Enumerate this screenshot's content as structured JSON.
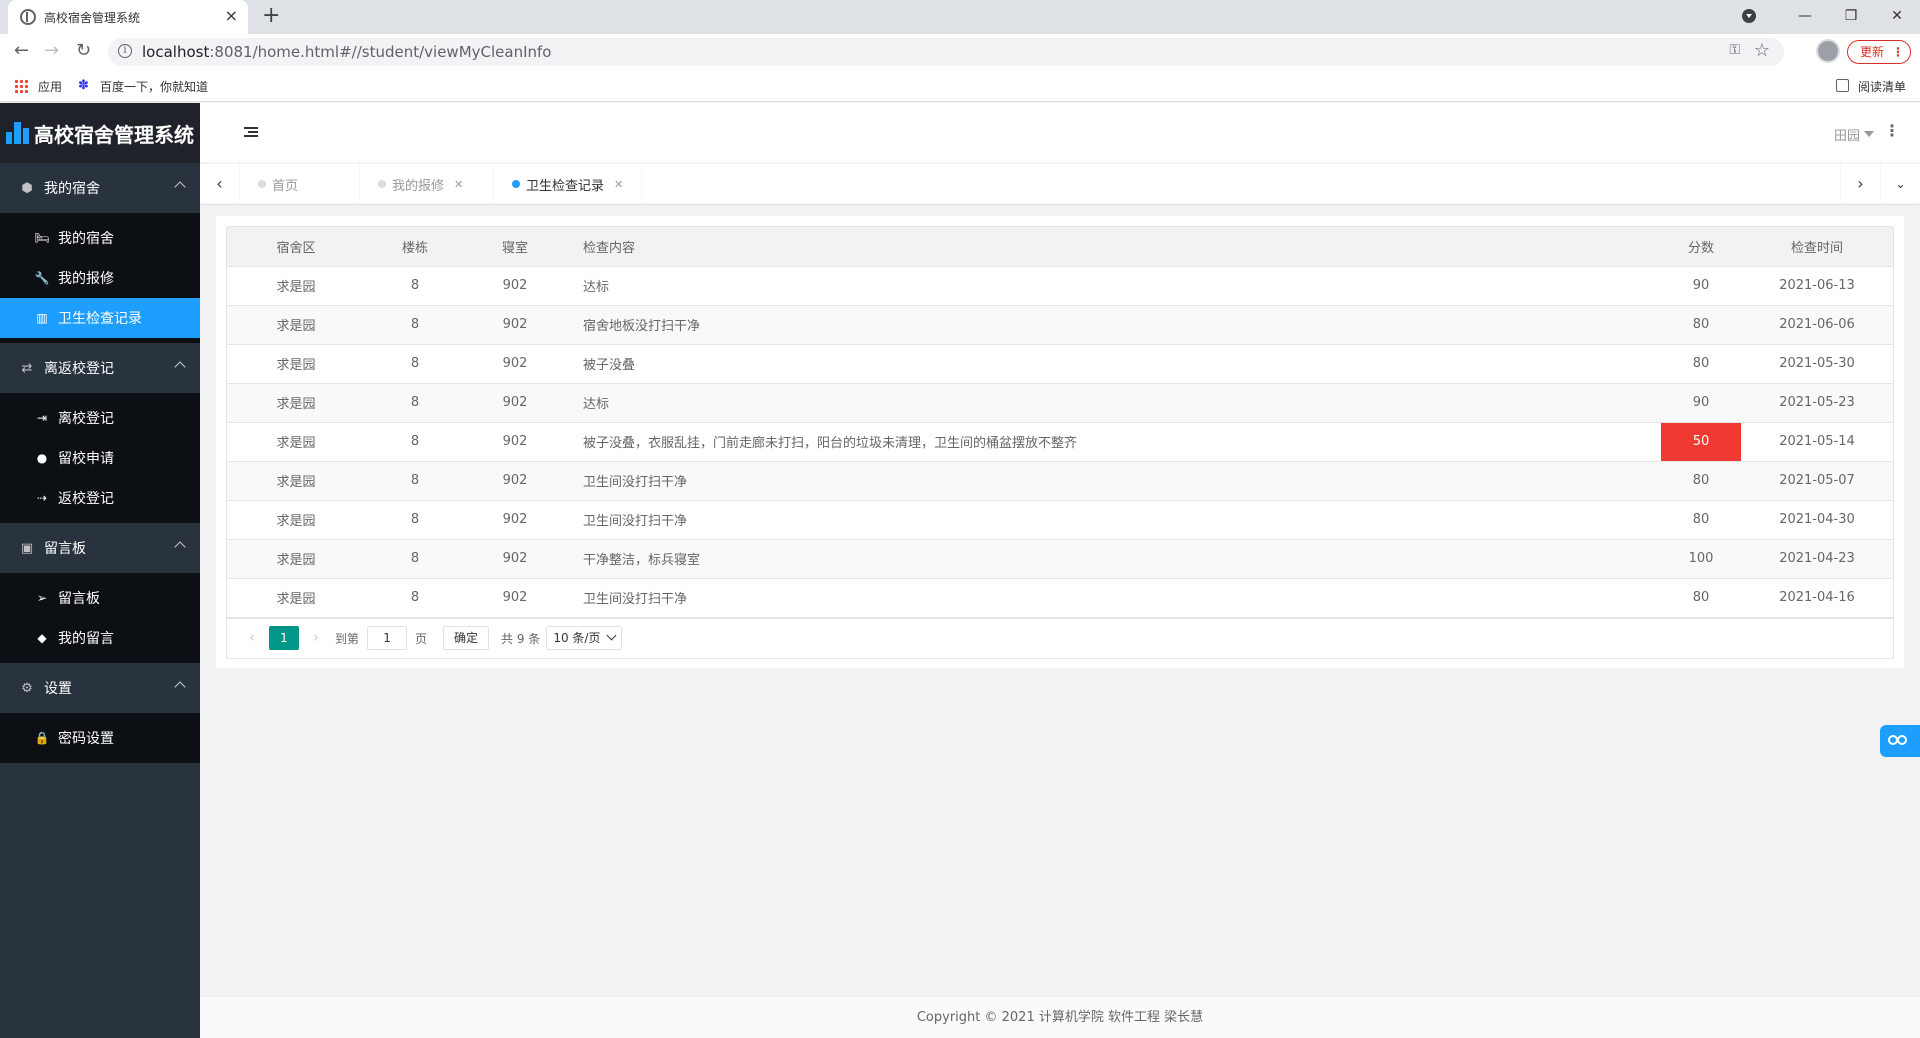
{
  "browser": {
    "tab_title": "高校宿舍管理系统",
    "url_host": "localhost",
    "url_rest": ":8081/home.html#//student/viewMyCleanInfo",
    "update_label": "更新",
    "bookmarks": [
      "应用",
      "百度一下，你就知道"
    ],
    "reading_list": "阅读清单"
  },
  "app": {
    "logo_text": "高校宿舍管理系统",
    "theme_label": "田园"
  },
  "sidebar": {
    "groups": [
      {
        "label": "我的宿舍",
        "icon": "cube-icon",
        "children": [
          {
            "label": "我的宿舍",
            "icon": "bed-icon"
          },
          {
            "label": "我的报修",
            "icon": "wrench-icon"
          },
          {
            "label": "卫生检查记录",
            "icon": "bar-chart-icon",
            "active": true
          }
        ]
      },
      {
        "label": "离返校登记",
        "icon": "exchange-icon",
        "children": [
          {
            "label": "离校登记",
            "icon": "sign-out-icon"
          },
          {
            "label": "留校申请",
            "icon": "globe-icon"
          },
          {
            "label": "返校登记",
            "icon": "sign-in-icon"
          }
        ]
      },
      {
        "label": "留言板",
        "icon": "calendar-icon",
        "children": [
          {
            "label": "留言板",
            "icon": "paper-plane-icon"
          },
          {
            "label": "我的留言",
            "icon": "tags-icon"
          }
        ]
      },
      {
        "label": "设置",
        "icon": "gear-icon",
        "children": [
          {
            "label": "密码设置",
            "icon": "lock-icon"
          }
        ]
      }
    ]
  },
  "page_tabs": [
    {
      "label": "首页"
    },
    {
      "label": "我的报修"
    },
    {
      "label": "卫生检查记录",
      "active": true
    }
  ],
  "table": {
    "headers": [
      "宿舍区",
      "楼栋",
      "寝室",
      "检查内容",
      "分数",
      "检查时间"
    ],
    "rows": [
      [
        "求是园",
        "8",
        "902",
        "达标",
        "90",
        "2021-06-13"
      ],
      [
        "求是园",
        "8",
        "902",
        "宿舍地板没打扫干净",
        "80",
        "2021-06-06"
      ],
      [
        "求是园",
        "8",
        "902",
        "被子没叠",
        "80",
        "2021-05-30"
      ],
      [
        "求是园",
        "8",
        "902",
        "达标",
        "90",
        "2021-05-23"
      ],
      [
        "求是园",
        "8",
        "902",
        "被子没叠，衣服乱挂，门前走廊未打扫，阳台的垃圾未清理，卫生间的桶盆摆放不整齐",
        "50",
        "2021-05-14"
      ],
      [
        "求是园",
        "8",
        "902",
        "卫生间没打扫干净",
        "80",
        "2021-05-07"
      ],
      [
        "求是园",
        "8",
        "902",
        "卫生间没打扫干净",
        "80",
        "2021-04-30"
      ],
      [
        "求是园",
        "8",
        "902",
        "干净整洁，标兵寝室",
        "100",
        "2021-04-23"
      ],
      [
        "求是园",
        "8",
        "902",
        "卫生间没打扫干净",
        "80",
        "2021-04-16"
      ]
    ],
    "low_score_color": "#ee3a32"
  },
  "pager": {
    "current_page": "1",
    "goto_label": "到第",
    "goto_value": "1",
    "page_suffix": "页",
    "confirm_label": "确定",
    "total_label": "共 9 条",
    "page_size": "10 条/页"
  },
  "footer": {
    "copyright": "Copyright © 2021 计算机学院 软件工程 梁长慧"
  },
  "colors": {
    "accent": "#1e9fff",
    "pager_active": "#009688",
    "sidebar_bg": "#28333e"
  }
}
